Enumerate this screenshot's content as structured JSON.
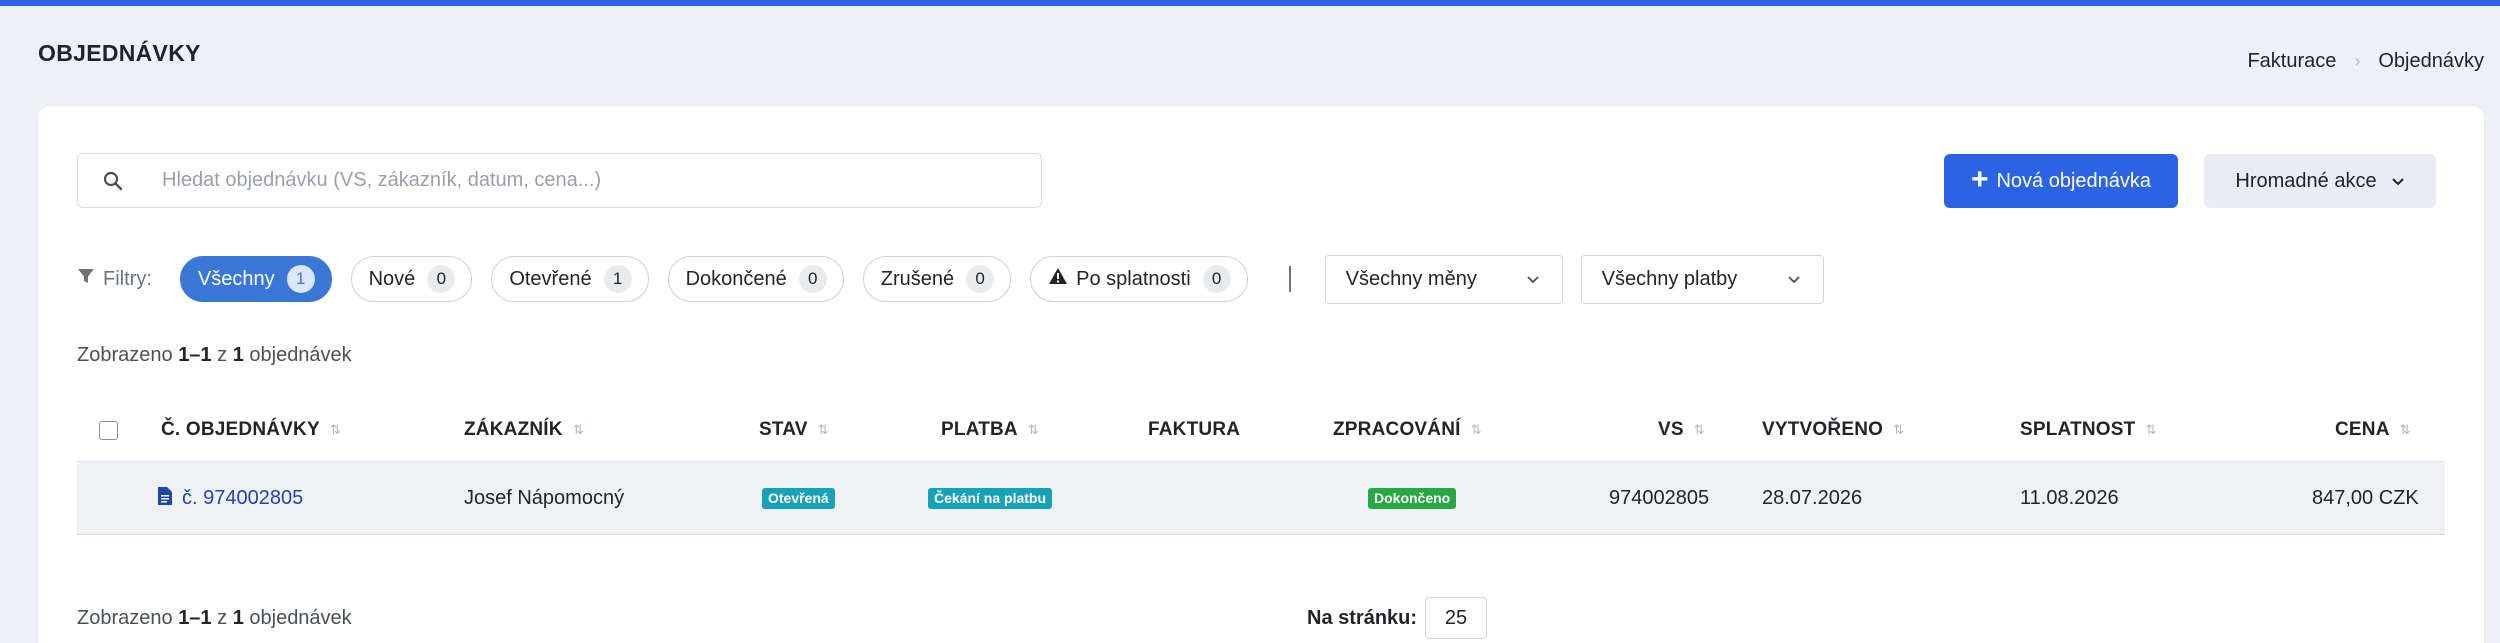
{
  "page": {
    "title": "OBJEDNÁVKY"
  },
  "breadcrumb": {
    "items": [
      "Fakturace",
      "Objednávky"
    ]
  },
  "search": {
    "placeholder": "Hledat objednávku (VS, zákazník, datum, cena...)",
    "value": ""
  },
  "actions": {
    "new_order": "Nová objednávka",
    "bulk": "Hromadné akce"
  },
  "filters": {
    "label": "Filtry:",
    "pills": [
      {
        "label": "Všechny",
        "count": "1",
        "active": true
      },
      {
        "label": "Nové",
        "count": "0"
      },
      {
        "label": "Otevřené",
        "count": "1"
      },
      {
        "label": "Dokončené",
        "count": "0"
      },
      {
        "label": "Zrušené",
        "count": "0"
      },
      {
        "label": "Po splatnosti",
        "count": "0",
        "icon": "warning-icon"
      }
    ],
    "currency_select": "Všechny měny",
    "payment_select": "Všechny platby"
  },
  "summary": {
    "prefix": "Zobrazeno",
    "range": "1–1",
    "mid": "z",
    "total": "1",
    "suffix": "objednávek"
  },
  "table": {
    "headers": [
      "Č. OBJEDNÁVKY",
      "ZÁKAZNÍK",
      "STAV",
      "PLATBA",
      "FAKTURA",
      "ZPRACOVÁNÍ",
      "VS",
      "VYTVOŘENO",
      "SPLATNOST",
      "CENA"
    ],
    "rows": [
      {
        "order": "č. 974002805",
        "customer": "Josef Nápomocný",
        "status": "Otevřená",
        "payment": "Čekání na platbu",
        "invoice": "",
        "processing": "Dokončeno",
        "vs": "974002805",
        "created": "28.07.2026",
        "due": "11.08.2026",
        "price": "847,00 CZK"
      }
    ]
  },
  "pagination": {
    "per_page_label": "Na stránku:",
    "per_page": "25"
  },
  "colors": {
    "accent": "#2b63e3",
    "status_open": "#17a2b8",
    "payment_waiting": "#17a2b8",
    "processing_done": "#28a745"
  }
}
